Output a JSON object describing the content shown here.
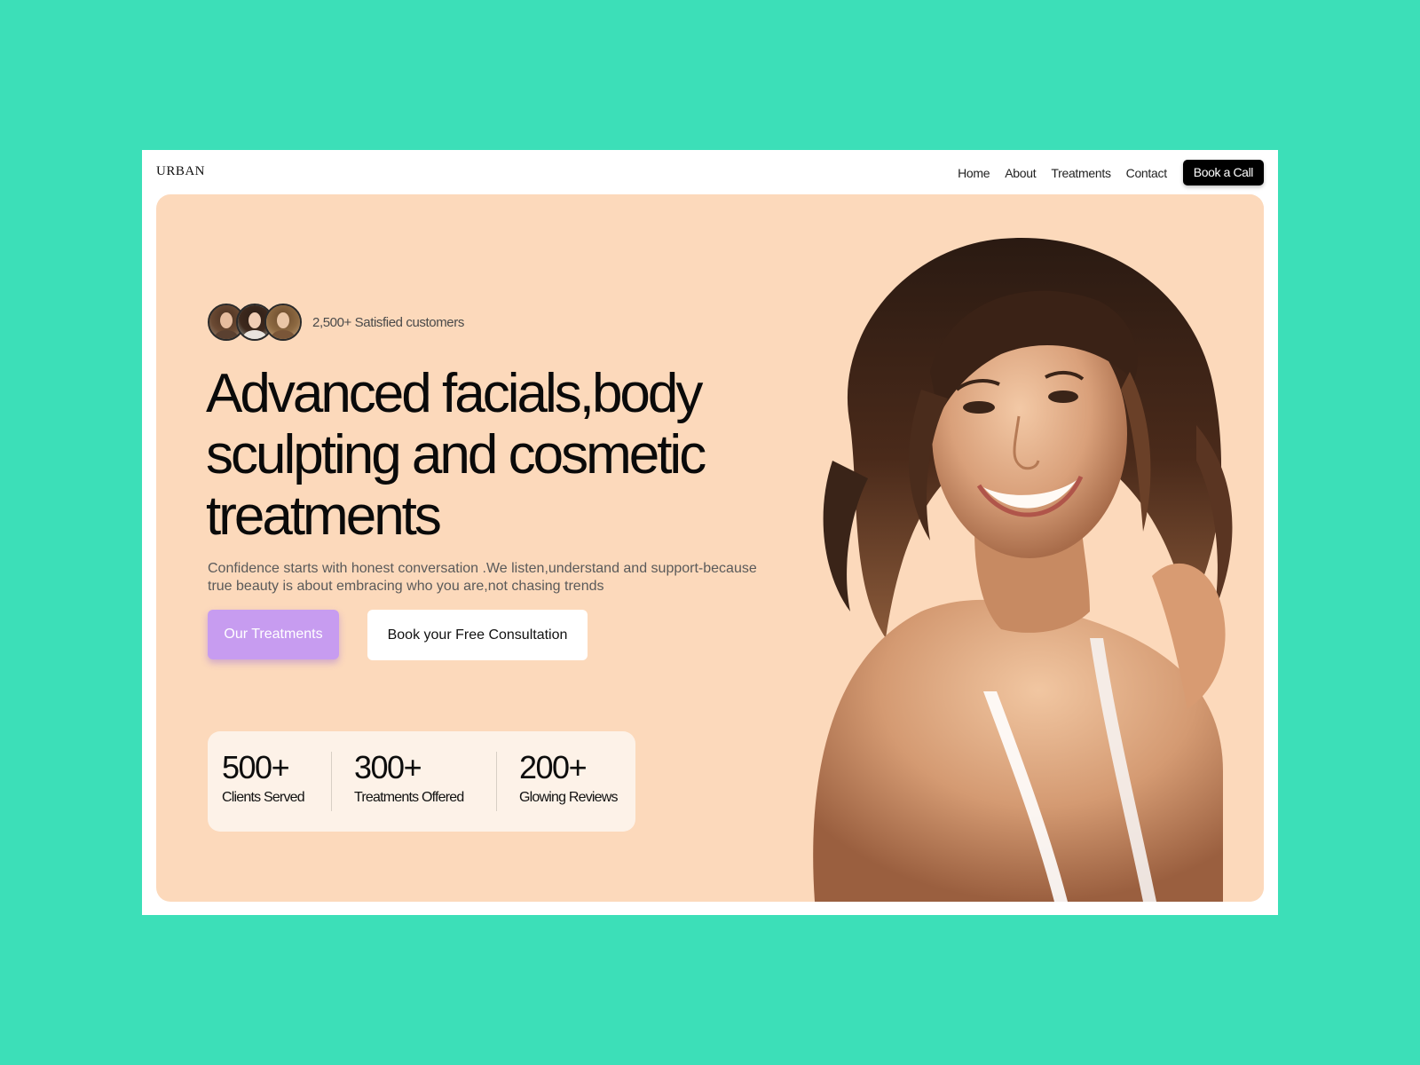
{
  "brand": {
    "logo": "URBAN"
  },
  "nav": {
    "items": [
      "Home",
      "About",
      "Treatments",
      "Contact"
    ],
    "cta_label": "Book a Call"
  },
  "hero": {
    "social_proof_text": "2,500+ Satisfied customers",
    "headline": "Advanced facials,body sculpting and cosmetic treatments",
    "subtext": "Confidence starts with honest conversation .We listen,understand and support-because true beauty is about embracing who you are,not chasing trends",
    "primary_button": "Our Treatments",
    "secondary_button": "Book your Free Consultation",
    "stats": [
      {
        "value": "500+",
        "label": "Clients Served"
      },
      {
        "value": "300+",
        "label": "Treatments Offered"
      },
      {
        "value": "200+",
        "label": "Glowing Reviews"
      }
    ]
  },
  "colors": {
    "page_background": "#3cdfb8",
    "hero_background": "#fcd9bb",
    "primary_button": "#c79cf0",
    "stats_card": "#fdf2e8",
    "cta_background": "#000000"
  }
}
